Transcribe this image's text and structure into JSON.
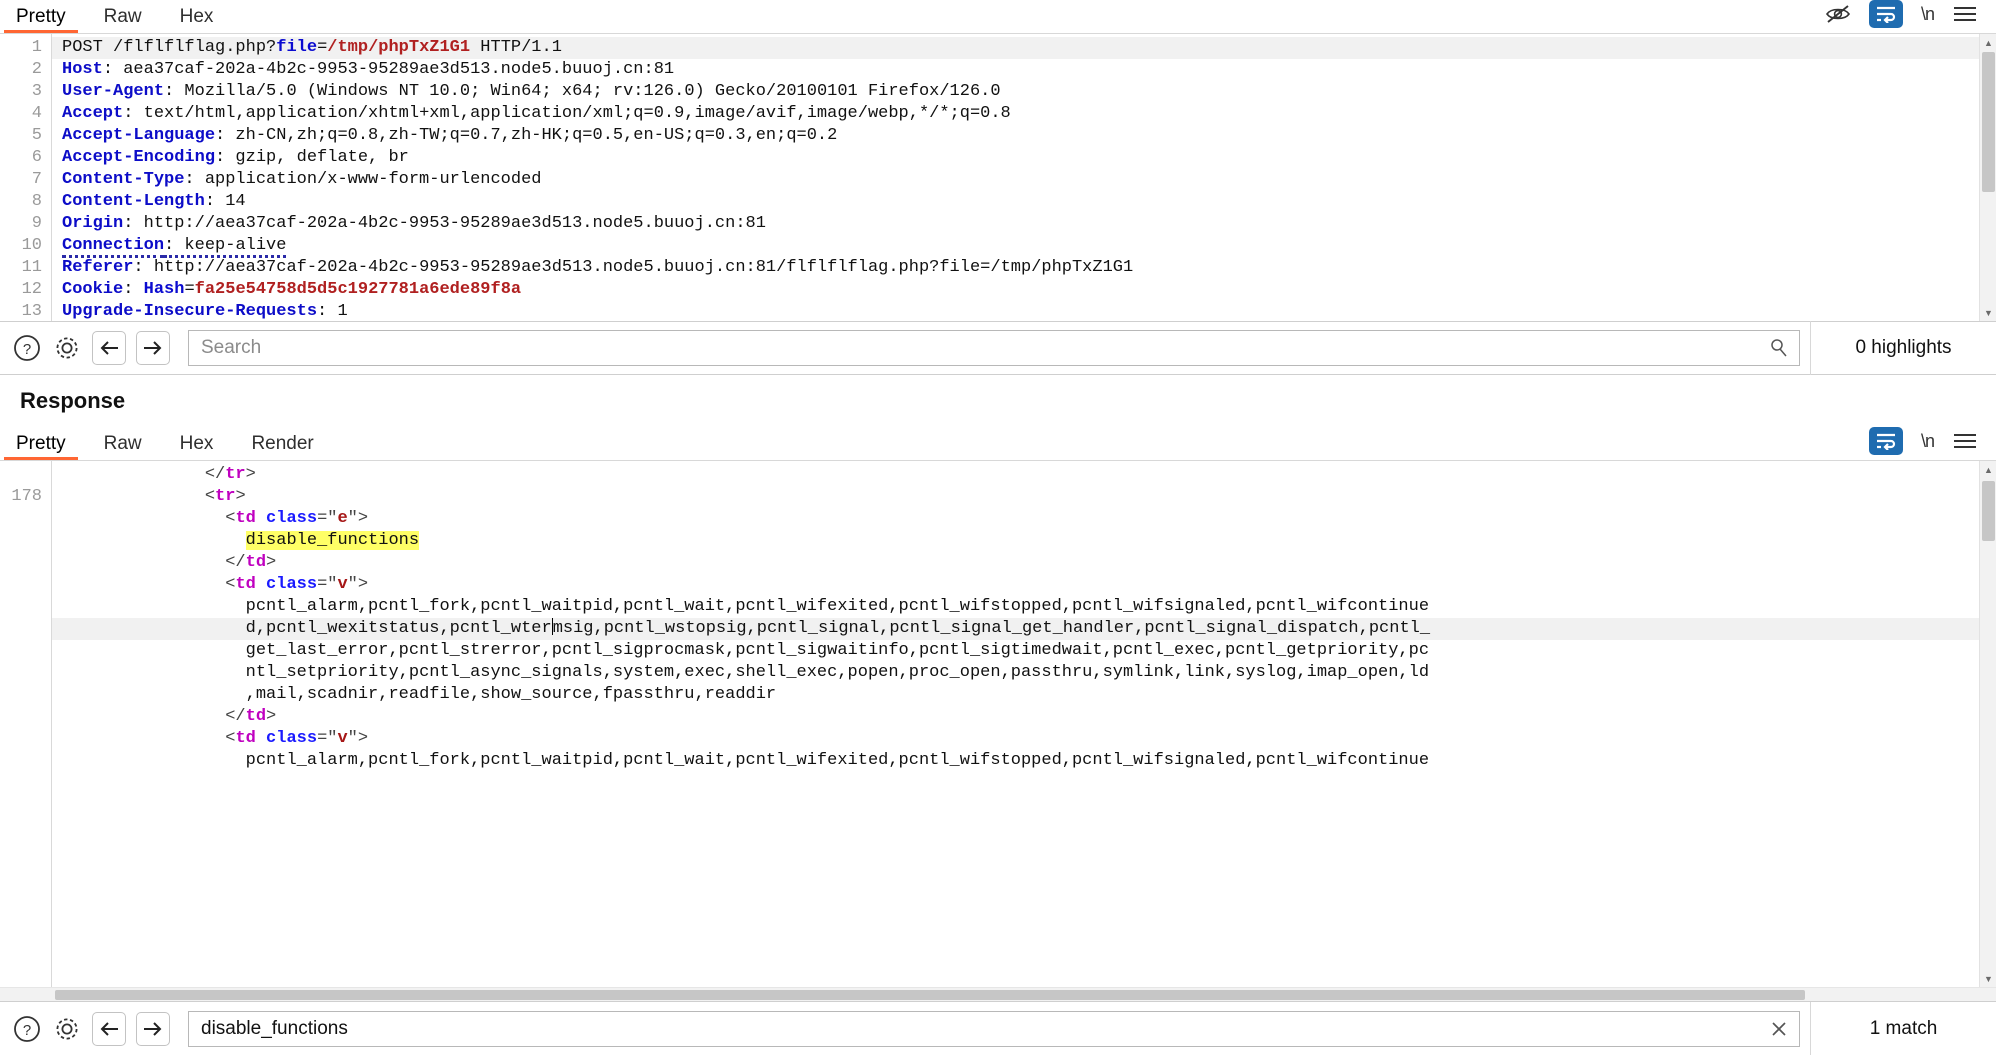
{
  "request_panel": {
    "tabs": [
      {
        "label": "Pretty",
        "active": true
      },
      {
        "label": "Raw",
        "active": false
      },
      {
        "label": "Hex",
        "active": false
      }
    ],
    "icons": {
      "eye_off": "eye-off-icon",
      "word_wrap": "word-wrap-icon",
      "newline_label": "\\n",
      "menu": "hamburger-menu-icon"
    },
    "line_numbers": [
      "1",
      "2",
      "3",
      "4",
      "5",
      "6",
      "7",
      "8",
      "9",
      "10",
      "11",
      "12",
      "13"
    ],
    "lines": [
      {
        "n": "1",
        "parts": [
          {
            "t": "POST /flflflflag.php?",
            "c": "plain"
          },
          {
            "t": "file",
            "c": "blue"
          },
          {
            "t": "=",
            "c": "plain"
          },
          {
            "t": "/tmp/phpTxZ1G1",
            "c": "red"
          },
          {
            "t": " HTTP/1.1",
            "c": "plain"
          }
        ]
      },
      {
        "n": "2",
        "parts": [
          {
            "t": "Host",
            "c": "hdr"
          },
          {
            "t": ": aea37caf-202a-4b2c-9953-95289ae3d513.node5.buuoj.cn:81",
            "c": "plain"
          }
        ]
      },
      {
        "n": "3",
        "parts": [
          {
            "t": "User-Agent",
            "c": "hdr"
          },
          {
            "t": ": Mozilla/5.0 (Windows NT 10.0; Win64; x64; rv:126.0) Gecko/20100101 Firefox/126.0",
            "c": "plain"
          }
        ]
      },
      {
        "n": "4",
        "parts": [
          {
            "t": "Accept",
            "c": "hdr"
          },
          {
            "t": ": text/html,application/xhtml+xml,application/xml;q=0.9,image/avif,image/webp,*/*;q=0.8",
            "c": "plain"
          }
        ]
      },
      {
        "n": "5",
        "parts": [
          {
            "t": "Accept-Language",
            "c": "hdr"
          },
          {
            "t": ": zh-CN,zh;q=0.8,zh-TW;q=0.7,zh-HK;q=0.5,en-US;q=0.3,en;q=0.2",
            "c": "plain"
          }
        ]
      },
      {
        "n": "6",
        "parts": [
          {
            "t": "Accept-Encoding",
            "c": "hdr"
          },
          {
            "t": ": gzip, deflate, br",
            "c": "plain"
          }
        ]
      },
      {
        "n": "7",
        "parts": [
          {
            "t": "Content-Type",
            "c": "hdr"
          },
          {
            "t": ": application/x-www-form-urlencoded",
            "c": "plain"
          }
        ]
      },
      {
        "n": "8",
        "parts": [
          {
            "t": "Content-Length",
            "c": "hdr"
          },
          {
            "t": ": 14",
            "c": "plain"
          }
        ]
      },
      {
        "n": "9",
        "parts": [
          {
            "t": "Origin",
            "c": "hdr"
          },
          {
            "t": ": http://aea37caf-202a-4b2c-9953-95289ae3d513.node5.buuoj.cn:81",
            "c": "plain"
          }
        ]
      },
      {
        "n": "10",
        "parts": [
          {
            "t": "Connection",
            "c": "hdr-spell"
          },
          {
            "t": ": keep-alive",
            "c": "plain-spell"
          }
        ]
      },
      {
        "n": "11",
        "parts": [
          {
            "t": "Referer",
            "c": "hdr"
          },
          {
            "t": ": http://aea37caf-202a-4b2c-9953-95289ae3d513.node5.buuoj.cn:81/flflflflag.php?file=/tmp/phpTxZ1G1",
            "c": "plain"
          }
        ]
      },
      {
        "n": "12",
        "parts": [
          {
            "t": "Cookie",
            "c": "hdr"
          },
          {
            "t": ": ",
            "c": "plain"
          },
          {
            "t": "Hash",
            "c": "blue"
          },
          {
            "t": "=",
            "c": "plain"
          },
          {
            "t": "fa25e54758d5d5c1927781a6ede89f8a",
            "c": "red"
          }
        ]
      },
      {
        "n": "13",
        "parts": [
          {
            "t": "Upgrade-Insecure-Requests",
            "c": "hdr"
          },
          {
            "t": ": 1",
            "c": "plain"
          }
        ]
      }
    ]
  },
  "request_search": {
    "placeholder": "Search",
    "value": "",
    "match_label": "0 highlights",
    "help_icon": "help-circle-icon",
    "settings_icon": "gear-icon",
    "back_icon": "arrow-left-icon",
    "forward_icon": "arrow-right-icon",
    "action_icon": "magnifier-icon"
  },
  "response_panel": {
    "title": "Response",
    "tabs": [
      {
        "label": "Pretty",
        "active": true
      },
      {
        "label": "Raw",
        "active": false
      },
      {
        "label": "Hex",
        "active": false
      },
      {
        "label": "Render",
        "active": false
      }
    ],
    "icons": {
      "word_wrap": "word-wrap-icon",
      "newline_label": "\\n",
      "menu": "hamburger-menu-icon"
    },
    "line_number": "178",
    "lines": [
      {
        "indent": 14,
        "parts": [
          {
            "t": "</",
            "c": "brk"
          },
          {
            "t": "tr",
            "c": "tag"
          },
          {
            "t": ">",
            "c": "brk"
          }
        ]
      },
      {
        "indent": 14,
        "parts": [
          {
            "t": "<",
            "c": "brk"
          },
          {
            "t": "tr",
            "c": "tag"
          },
          {
            "t": ">",
            "c": "brk"
          }
        ]
      },
      {
        "indent": 16,
        "parts": [
          {
            "t": "<",
            "c": "brk"
          },
          {
            "t": "td",
            "c": "tag"
          },
          {
            "t": " ",
            "c": "txt"
          },
          {
            "t": "class",
            "c": "attr"
          },
          {
            "t": "=\"",
            "c": "brk"
          },
          {
            "t": "e",
            "c": "val"
          },
          {
            "t": "\">",
            "c": "brk"
          }
        ]
      },
      {
        "indent": 18,
        "parts": [
          {
            "t": "disable_functions",
            "c": "mark"
          }
        ]
      },
      {
        "indent": 16,
        "parts": [
          {
            "t": "</",
            "c": "brk"
          },
          {
            "t": "td",
            "c": "tag"
          },
          {
            "t": ">",
            "c": "brk"
          }
        ]
      },
      {
        "indent": 16,
        "parts": [
          {
            "t": "<",
            "c": "brk"
          },
          {
            "t": "td",
            "c": "tag"
          },
          {
            "t": " ",
            "c": "txt"
          },
          {
            "t": "class",
            "c": "attr"
          },
          {
            "t": "=\"",
            "c": "brk"
          },
          {
            "t": "v",
            "c": "val"
          },
          {
            "t": "\">",
            "c": "brk"
          }
        ]
      },
      {
        "indent": 18,
        "parts": [
          {
            "t": "pcntl_alarm,pcntl_fork,pcntl_waitpid,pcntl_wait,pcntl_wifexited,pcntl_wifstopped,pcntl_wifsignaled,pcntl_wifcontinue",
            "c": "txt"
          }
        ]
      },
      {
        "indent": 18,
        "hl": true,
        "caret_after": 30,
        "parts": [
          {
            "t": "d,pcntl_wexitstatus,pcntl_wtermsig,pcntl_wstopsig,pcntl_signal,pcntl_signal_get_handler,pcntl_signal_dispatch,pcntl_",
            "c": "txt"
          }
        ]
      },
      {
        "indent": 18,
        "parts": [
          {
            "t": "get_last_error,pcntl_strerror,pcntl_sigprocmask,pcntl_sigwaitinfo,pcntl_sigtimedwait,pcntl_exec,pcntl_getpriority,pc",
            "c": "txt"
          }
        ]
      },
      {
        "indent": 18,
        "parts": [
          {
            "t": "ntl_setpriority,pcntl_async_signals,system,exec,shell_exec,popen,proc_open,passthru,symlink,link,syslog,imap_open,ld",
            "c": "txt"
          }
        ]
      },
      {
        "indent": 18,
        "parts": [
          {
            "t": ",mail,scadnir,readfile,show_source,fpassthru,readdir",
            "c": "txt"
          }
        ]
      },
      {
        "indent": 16,
        "parts": [
          {
            "t": "</",
            "c": "brk"
          },
          {
            "t": "td",
            "c": "tag"
          },
          {
            "t": ">",
            "c": "brk"
          }
        ]
      },
      {
        "indent": 16,
        "parts": [
          {
            "t": "<",
            "c": "brk"
          },
          {
            "t": "td",
            "c": "tag"
          },
          {
            "t": " ",
            "c": "txt"
          },
          {
            "t": "class",
            "c": "attr"
          },
          {
            "t": "=\"",
            "c": "brk"
          },
          {
            "t": "v",
            "c": "val"
          },
          {
            "t": "\">",
            "c": "brk"
          }
        ]
      },
      {
        "indent": 18,
        "parts": [
          {
            "t": "pcntl_alarm,pcntl_fork,pcntl_waitpid,pcntl_wait,pcntl_wifexited,pcntl_wifstopped,pcntl_wifsignaled,pcntl_wifcontinue",
            "c": "txt"
          }
        ]
      }
    ]
  },
  "response_search": {
    "placeholder": "Search",
    "value": "disable_functions",
    "match_label": "1 match",
    "help_icon": "help-circle-icon",
    "settings_icon": "gear-icon",
    "back_icon": "arrow-left-icon",
    "forward_icon": "arrow-right-icon",
    "action_icon": "close-icon"
  },
  "colors": {
    "accent": "#ff6633",
    "wrap_active_bg": "#1f6cb0",
    "highlight": "#ffff66",
    "header_blue": "#0c0cc8",
    "value_red": "#b02020"
  }
}
